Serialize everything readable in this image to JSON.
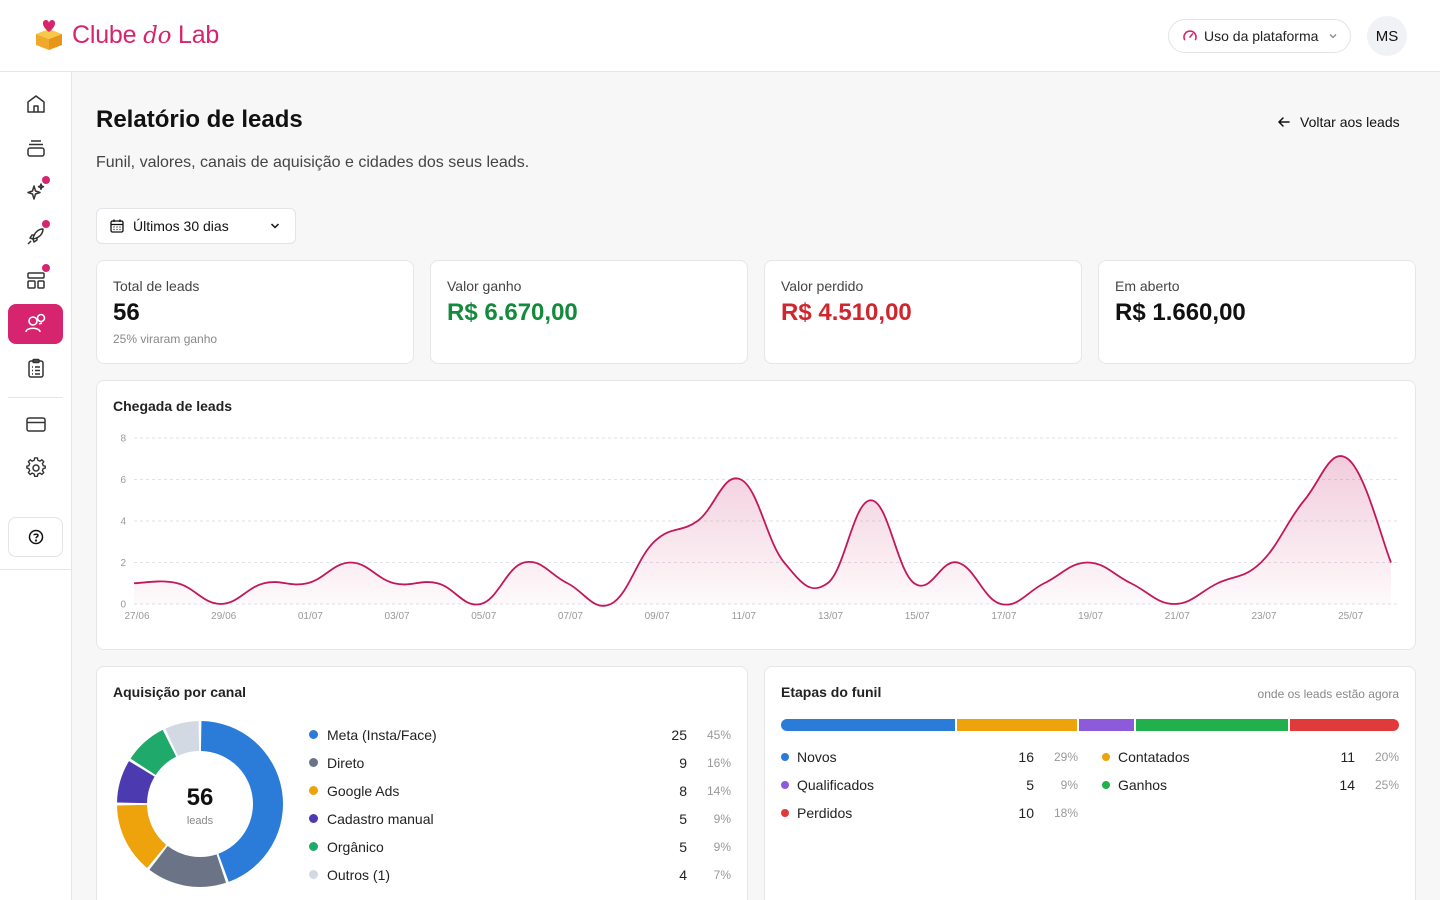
{
  "brand": {
    "name_start": "Clube ",
    "name_mid": "do",
    "name_end": " Lab",
    "color": "#d6246e"
  },
  "topbar": {
    "usage_label": "Uso da plataforma",
    "avatar_initials": "MS"
  },
  "sidebar": {
    "items": [
      {
        "icon": "home-icon"
      },
      {
        "icon": "stack-icon"
      },
      {
        "icon": "sparkles-icon",
        "badge": true
      },
      {
        "icon": "rocket-icon",
        "badge": true
      },
      {
        "icon": "layout-icon",
        "badge": true
      },
      {
        "icon": "users-icon",
        "active": true
      },
      {
        "icon": "clipboard-icon"
      },
      {
        "icon": "credit-card-icon"
      },
      {
        "icon": "gear-icon"
      }
    ],
    "help_icon": "question-icon"
  },
  "header": {
    "title": "Relatório de leads",
    "subtitle": "Funil, valores, canais de aquisição e cidades dos seus leads.",
    "back_label": "Voltar aos leads"
  },
  "filter": {
    "date_range": "Últimos 30 dias"
  },
  "kpis": [
    {
      "label": "Total de leads",
      "value": "56",
      "note": "25% viraram ganho"
    },
    {
      "label": "Valor ganho",
      "value": "R$ 6.670,00"
    },
    {
      "label": "Valor perdido",
      "value": "R$ 4.510,00"
    },
    {
      "label": "Em aberto",
      "value": "R$ 1.660,00"
    }
  ],
  "arrivals_title": "Chegada de leads",
  "chart_data": {
    "type": "area",
    "title": "Chegada de leads",
    "x": [
      "27/06",
      "28/06",
      "29/06",
      "30/06",
      "01/07",
      "02/07",
      "03/07",
      "04/07",
      "05/07",
      "06/07",
      "07/07",
      "08/07",
      "09/07",
      "10/07",
      "11/07",
      "12/07",
      "13/07",
      "14/07",
      "15/07",
      "16/07",
      "17/07",
      "18/07",
      "19/07",
      "20/07",
      "21/07",
      "22/07",
      "23/07",
      "24/07",
      "25/07"
    ],
    "x_tick_labels": [
      "27/06",
      "29/06",
      "01/07",
      "03/07",
      "05/07",
      "07/07",
      "09/07",
      "11/07",
      "13/07",
      "15/07",
      "17/07",
      "19/07",
      "21/07",
      "23/07",
      "25/07"
    ],
    "series": [
      {
        "values": [
          1,
          1,
          0,
          1,
          1,
          2,
          1,
          1,
          0,
          2,
          1,
          0,
          3,
          4,
          6,
          2,
          1,
          5,
          1,
          2,
          0,
          1,
          2,
          1,
          0,
          1,
          2,
          5,
          7,
          2
        ]
      }
    ],
    "ylim": [
      0,
      8
    ],
    "y_ticks": [
      0,
      2,
      4,
      6,
      8
    ],
    "color": "#c2185b",
    "grid": true
  },
  "acquisition": {
    "title": "Aquisição por canal",
    "total": "56",
    "total_label": "leads",
    "channels": [
      {
        "name": "Meta (Insta/Face)",
        "count": "25",
        "pct": "45%",
        "value": 25,
        "color": "#2b7bd9"
      },
      {
        "name": "Direto",
        "count": "9",
        "pct": "16%",
        "value": 9,
        "color": "#6b7487"
      },
      {
        "name": "Google Ads",
        "count": "8",
        "pct": "14%",
        "value": 8,
        "color": "#eea20c"
      },
      {
        "name": "Cadastro manual",
        "count": "5",
        "pct": "9%",
        "value": 5,
        "color": "#4c3bb0"
      },
      {
        "name": "Orgânico",
        "count": "5",
        "pct": "9%",
        "value": 5,
        "color": "#1faa6b"
      },
      {
        "name": "Outros (1)",
        "count": "4",
        "pct": "7%",
        "value": 4,
        "color": "#d3d9e3"
      }
    ]
  },
  "funnel": {
    "title": "Etapas do funil",
    "note": "onde os leads estão agora",
    "stages": [
      {
        "name": "Novos",
        "count": "16",
        "pct": "29%",
        "value": 16,
        "color": "#2b7bd9"
      },
      {
        "name": "Contatados",
        "count": "11",
        "pct": "20%",
        "value": 11,
        "color": "#eea20c"
      },
      {
        "name": "Qualificados",
        "count": "5",
        "pct": "9%",
        "value": 5,
        "color": "#8d5bd9"
      },
      {
        "name": "Ganhos",
        "count": "14",
        "pct": "25%",
        "value": 14,
        "color": "#22b04c"
      },
      {
        "name": "Perdidos",
        "count": "10",
        "pct": "18%",
        "value": 10,
        "color": "#e03a3a"
      }
    ]
  }
}
